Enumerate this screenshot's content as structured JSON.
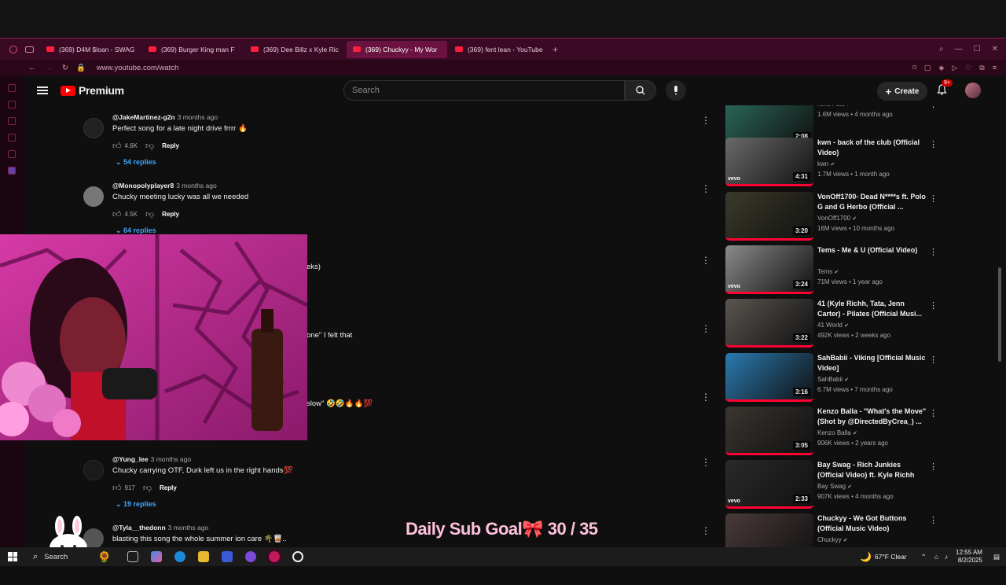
{
  "browser": {
    "tabs": [
      {
        "label": "(369) D4M $loan - SWAG"
      },
      {
        "label": "(369) Burger King man F"
      },
      {
        "label": "(369) Dee Billz x Kyle Ric"
      },
      {
        "label": "(369) Chuckyy - My Wor"
      },
      {
        "label": "(369) fent lean - YouTube"
      }
    ],
    "active_tab": 3,
    "url": "www.youtube.com/watch"
  },
  "youtube": {
    "logo_text": "Premium",
    "search_placeholder": "Search",
    "create_label": "Create",
    "notif_badge": "9+"
  },
  "comments": [
    {
      "user": "@JakeMartinez-g2n",
      "time": "3 months ago",
      "text": "Perfect song for a late night drive frrrr 🔥",
      "likes": "4.6K",
      "reply": "Reply",
      "replies": "54 replies"
    },
    {
      "user": "@Monopolyplayer8",
      "time": "3 months ago",
      "text": "Chucky meeting lucky was all we needed",
      "likes": "4.5K",
      "reply": "Reply",
      "replies": "64 replies"
    },
    {
      "text_fragment": "eks)"
    },
    {
      "text_fragment": "one\" I felt that"
    },
    {
      "text_fragment": "slow\" 🤣🤣🔥🔥💯"
    },
    {
      "user": "@Yung_lee",
      "time": "3 months ago",
      "text": "Chucky carrying OTF, Durk left us in the right hands💯",
      "likes": "917",
      "reply": "Reply",
      "replies": "19 replies"
    },
    {
      "user": "@Tyla__thedonn",
      "time": "3 months ago",
      "text": "blasting this song the whole summer ion care 🌴🥃.."
    }
  ],
  "recommendations": [
    {
      "title": "",
      "channel": "Nino Paid",
      "meta": "1.6M views • 4 months ago",
      "duration": "2:08",
      "vevo": false,
      "color": "#2a6a5a"
    },
    {
      "title": "kwn - back of the club (Official Video)",
      "channel": "kwn",
      "meta": "1.7M views • 1 month ago",
      "duration": "4:31",
      "vevo": true,
      "color": "#6a6a6a"
    },
    {
      "title": "VonOff1700- Dead N****s ft. Polo G and G Herbo (Official ...",
      "channel": "VonOff1700",
      "meta": "16M views • 10 months ago",
      "duration": "3:20",
      "vevo": false,
      "color": "#3a3a2a"
    },
    {
      "title": "Tems - Me & U (Official Video)",
      "channel": "Tems",
      "meta": "71M views • 1 year ago",
      "duration": "3:24",
      "vevo": true,
      "color": "#8a8a8a"
    },
    {
      "title": "41 (Kyle Richh, Tata, Jenn Carter) - Pilates (Official Musi...",
      "channel": "41 World",
      "meta": "492K views • 2 weeks ago",
      "duration": "3:22",
      "vevo": false,
      "color": "#5a5550"
    },
    {
      "title": "SahBabii - Viking [Official Music Video]",
      "channel": "SahBabii",
      "meta": "6.7M views • 7 months ago",
      "duration": "3:16",
      "vevo": false,
      "color": "#2a7ab0"
    },
    {
      "title": "Kenzo Balla - \"What's the Move\" (Shot by @DirectedByCrea_) ...",
      "channel": "Kenzo Balla",
      "meta": "906K views • 2 years ago",
      "duration": "3:05",
      "vevo": false,
      "color": "#3a3530"
    },
    {
      "title": "Bay Swag - Rich Junkies (Official Video) ft. Kyle Richh",
      "channel": "Bay Swag",
      "meta": "907K views • 4 months ago",
      "duration": "2:33",
      "vevo": true,
      "color": "#2a2a2a"
    },
    {
      "title": "Chuckyy - We Got Buttons (Official Music Video)",
      "channel": "Chuckyy",
      "meta": "",
      "duration": "",
      "vevo": false,
      "color": "#4a3a3a"
    }
  ],
  "overlay": {
    "sub_goal": "Daily Sub Goal🎀  30 / 35"
  },
  "taskbar": {
    "search_label": "Search",
    "weather": "67°F  Clear",
    "time": "12:55 AM",
    "date": "8/2/2025"
  }
}
